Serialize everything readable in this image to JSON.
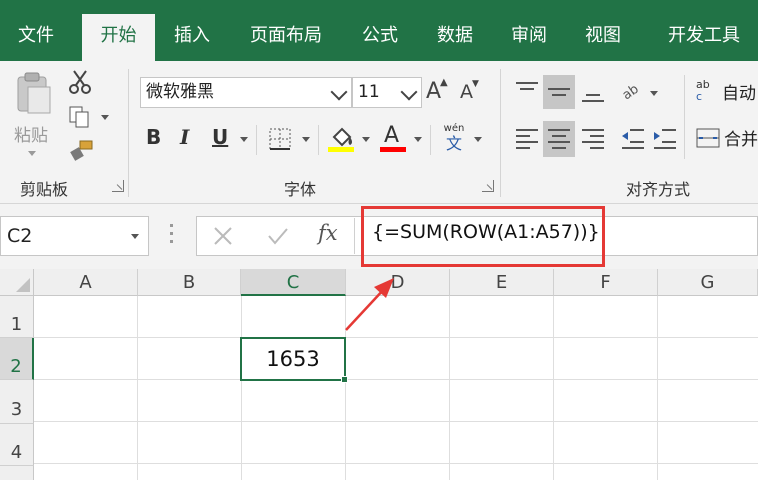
{
  "tabs": [
    {
      "label": "文件"
    },
    {
      "label": "开始",
      "active": true
    },
    {
      "label": "插入"
    },
    {
      "label": "页面布局"
    },
    {
      "label": "公式"
    },
    {
      "label": "数据"
    },
    {
      "label": "审阅"
    },
    {
      "label": "视图"
    },
    {
      "label": "开发工具"
    }
  ],
  "ribbon": {
    "clipboard": {
      "paste_label": "粘贴",
      "group_label": "剪贴板"
    },
    "font": {
      "font_name": "微软雅黑",
      "font_size": "11",
      "grow_label": "A",
      "shrink_label": "A",
      "bold_label": "B",
      "italic_label": "I",
      "underline_label": "U",
      "font_color_label": "A",
      "phonetic_label_top": "wén",
      "phonetic_label_bottom": "文",
      "group_label": "字体",
      "highlight_color": "#ffff00",
      "font_color": "#ff0000"
    },
    "alignment": {
      "wrap_label": "自动",
      "merge_label": "合并",
      "group_label": "对齐方式",
      "wrap_icon_top": "ab",
      "wrap_icon_bottom": "c"
    }
  },
  "formula_bar": {
    "name_box": "C2",
    "fx_label": "fx",
    "formula": "{=SUM(ROW(A1:A57))}"
  },
  "grid": {
    "columns": [
      "A",
      "B",
      "C",
      "D",
      "E",
      "F",
      "G"
    ],
    "selected_column": "C",
    "rows": [
      "1",
      "2",
      "3",
      "4"
    ],
    "selected_row": "2",
    "active_cell": {
      "ref": "C2",
      "value": "1653"
    }
  },
  "colors": {
    "accent": "#217346",
    "highlight": "#e53935"
  }
}
